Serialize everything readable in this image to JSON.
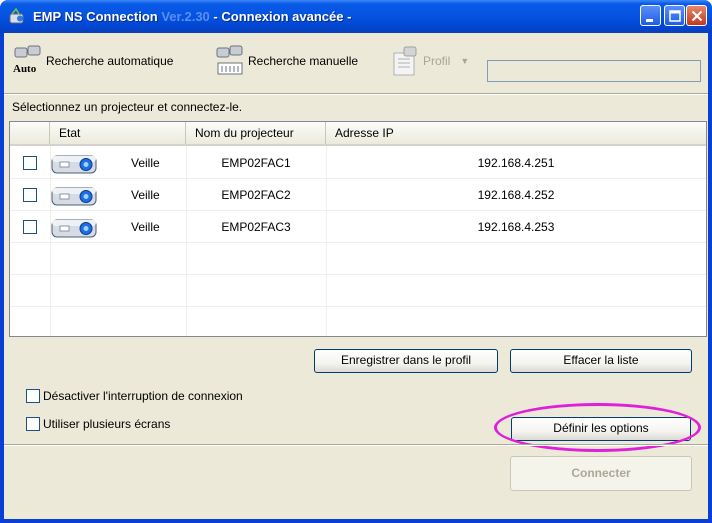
{
  "window": {
    "title_main": "EMP NS Connection",
    "title_version": "Ver.2.30",
    "title_sub": "- Connexion avancée -"
  },
  "toolbar": {
    "auto_icon_text": "Auto",
    "auto_label": "Recherche automatique",
    "manual_label": "Recherche manuelle",
    "profil_label": "Profil",
    "profil_value": ""
  },
  "instruction": "Sélectionnez un projecteur et connectez-le.",
  "list": {
    "columns": [
      "Etat",
      "Nom du projecteur",
      "Adresse IP"
    ],
    "rows": [
      {
        "checked": false,
        "etat": "Veille",
        "name": "EMP02FAC1",
        "ip": "192.168.4.251"
      },
      {
        "checked": false,
        "etat": "Veille",
        "name": "EMP02FAC2",
        "ip": "192.168.4.252"
      },
      {
        "checked": false,
        "etat": "Veille",
        "name": "EMP02FAC3",
        "ip": "192.168.4.253"
      }
    ]
  },
  "buttons": {
    "save_profile": "Enregistrer dans le profil",
    "clear_list": "Effacer la liste",
    "set_options": "Définir les options",
    "connect": "Connecter"
  },
  "options": {
    "disable_interrupt": "Désactiver l'interruption de connexion",
    "multi_screens": "Utiliser plusieurs écrans"
  },
  "colors": {
    "titlebar": "#0453e0",
    "client_bg": "#ece9d8",
    "highlight": "#e020d8"
  }
}
